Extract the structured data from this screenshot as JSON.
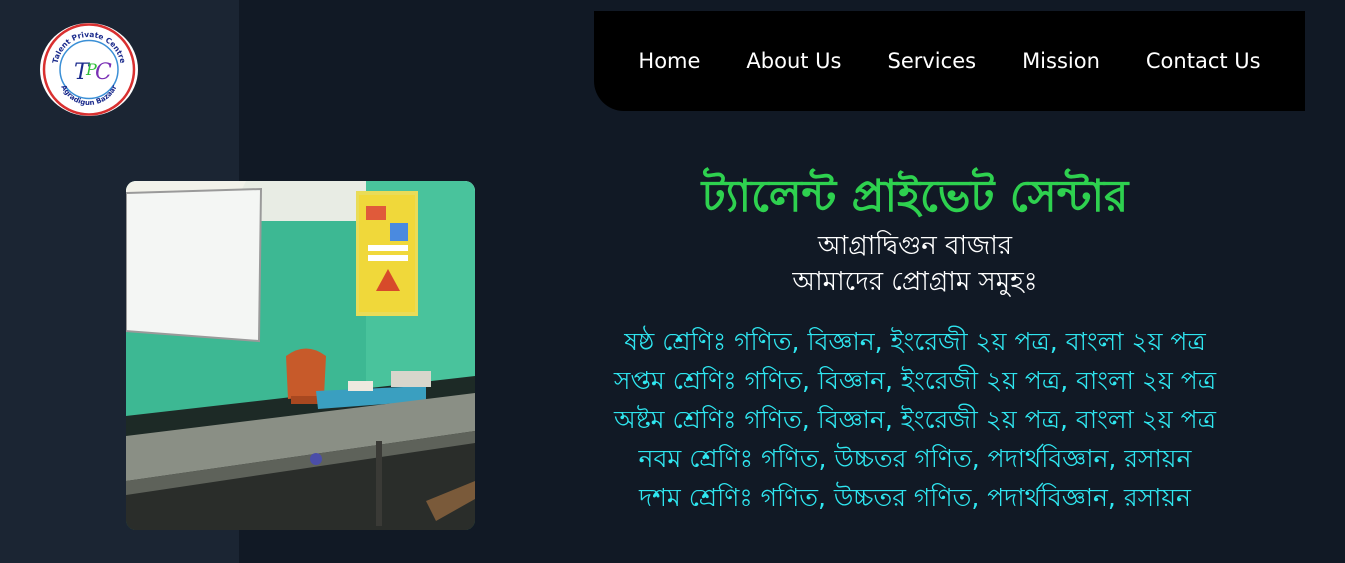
{
  "logo": {
    "text_top": "Talent Private Centre",
    "text_bottom": "Agradigun Bazaar",
    "initials": "TPC"
  },
  "nav": {
    "items": [
      {
        "label": "Home"
      },
      {
        "label": "About Us"
      },
      {
        "label": "Services"
      },
      {
        "label": "Mission"
      },
      {
        "label": "Contact Us"
      }
    ]
  },
  "main": {
    "title": "ট্যালেন্ট প্রাইভেট সেন্টার",
    "location": "আগ্রাদ্বিগুন বাজার",
    "programs_heading": "আমাদের প্রোগ্রাম সমুহঃ",
    "programs": [
      "ষষ্ঠ শ্রেণিঃ গণিত, বিজ্ঞান, ইংরেজী ২য় পত্র, বাংলা ২য় পত্র",
      "সপ্তম শ্রেণিঃ গণিত, বিজ্ঞান, ইংরেজী ২য় পত্র, বাংলা ২য় পত্র",
      "অষ্টম শ্রেণিঃ গণিত, বিজ্ঞান, ইংরেজী ২য় পত্র, বাংলা ২য় পত্র",
      "নবম শ্রেণিঃ গণিত, উচ্চতর গণিত, পদার্থবিজ্ঞান, রসায়ন",
      "দশম শ্রেণিঃ গণিত, উচ্চতর গণিত, পদার্থবিজ্ঞান, রসায়ন"
    ]
  },
  "colors": {
    "title": "#2ed14f",
    "programs": "#2fe6f0",
    "navbar": "#000000",
    "background": "#111925",
    "left_panel": "#1b2533"
  }
}
